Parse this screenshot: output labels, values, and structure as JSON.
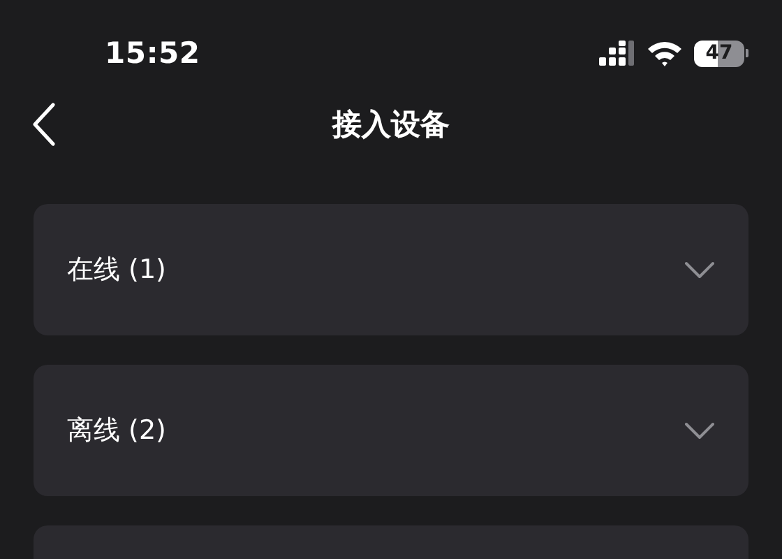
{
  "status_bar": {
    "time": "15:52",
    "battery": "47"
  },
  "nav": {
    "title": "接入设备"
  },
  "sections": [
    {
      "kind": "group",
      "label": "在线 (1)",
      "expanded": false
    },
    {
      "kind": "group",
      "label": "离线 (2)",
      "expanded": false
    },
    {
      "kind": "partial"
    }
  ]
}
